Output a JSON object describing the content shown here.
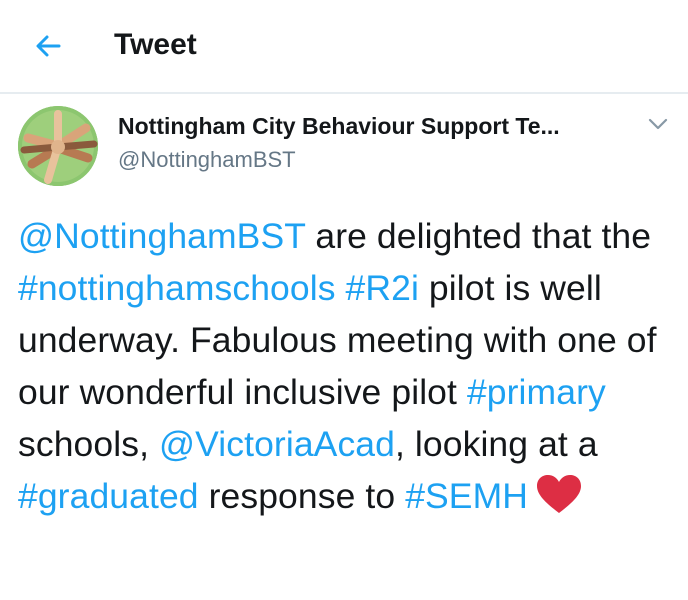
{
  "header": {
    "title": "Tweet",
    "back_icon": "arrow-left-icon",
    "accent_color": "#1da1f2"
  },
  "author": {
    "display_name": "Nottingham City Behaviour Support Te...",
    "handle": "@NottinghamBST",
    "avatar_icon": "avatar-image-hands-circle",
    "menu_icon": "chevron-down-icon"
  },
  "tweet": {
    "segments": [
      {
        "text": "@NottinghamBST",
        "link": true
      },
      {
        "text": " are delighted that the ",
        "link": false
      },
      {
        "text": "#nottinghamschools",
        "link": true
      },
      {
        "text": " ",
        "link": false
      },
      {
        "text": "#R2i",
        "link": true
      },
      {
        "text": " pilot is well underway. Fabulous meeting with one of our wonderful inclusive pilot ",
        "link": false
      },
      {
        "text": "#primary",
        "link": true
      },
      {
        "text": " schools, ",
        "link": false
      },
      {
        "text": "@VictoriaAcad",
        "link": true
      },
      {
        "text": ", looking at a ",
        "link": false
      },
      {
        "text": "#graduated",
        "link": true
      },
      {
        "text": " response to ",
        "link": false
      },
      {
        "text": "#SEMH",
        "link": true
      }
    ],
    "emoji_icon": "red-heart-icon",
    "text_color": "#14171a",
    "link_color": "#1da1f2",
    "muted_color": "#657786"
  }
}
